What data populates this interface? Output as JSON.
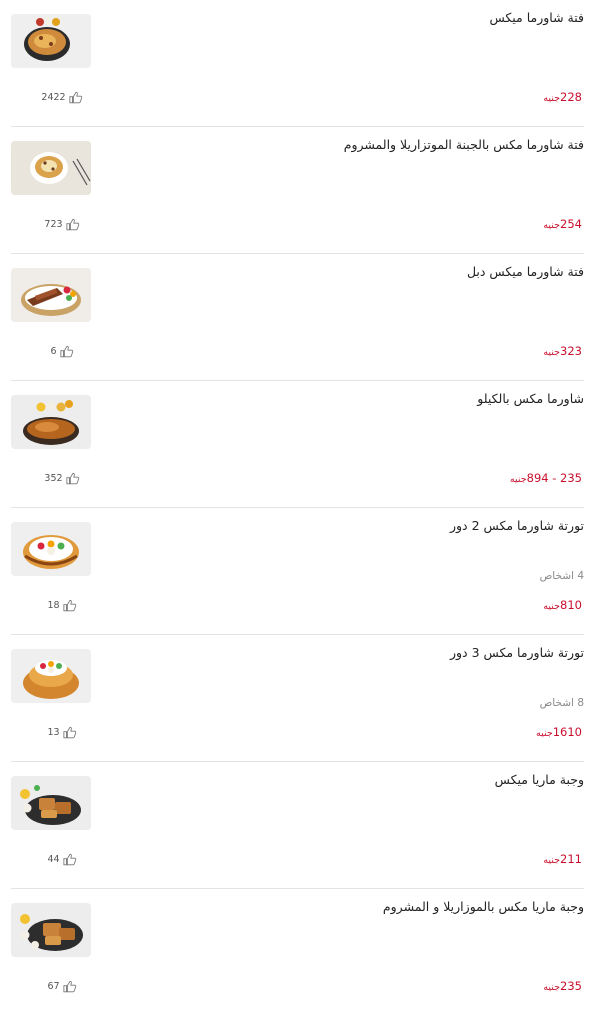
{
  "currency": "جنيه",
  "items": [
    {
      "name": "فتة شاورما ميكس",
      "serves": "",
      "price": "228",
      "likes": "2422"
    },
    {
      "name": "فتة شاورما مكس بالجبنة الموتزاريلا والمشروم",
      "serves": "",
      "price": "254",
      "likes": "723"
    },
    {
      "name": "فتة شاورما ميكس دبل",
      "serves": "",
      "price": "323",
      "likes": "6"
    },
    {
      "name": "شاورما مكس بالكيلو",
      "serves": "",
      "price": "235 - 894",
      "likes": "352"
    },
    {
      "name": "تورتة شاورما مكس 2 دور",
      "serves": "4 اشخاص",
      "price": "810",
      "likes": "18"
    },
    {
      "name": "تورتة شاورما مكس 3 دور",
      "serves": "8 اشخاص",
      "price": "1610",
      "likes": "13"
    },
    {
      "name": "وجبة ماريا ميكس",
      "serves": "",
      "price": "211",
      "likes": "44"
    },
    {
      "name": "وجبة ماريا مكس بالموزاريلا و المشروم",
      "serves": "",
      "price": "235",
      "likes": "67"
    }
  ]
}
